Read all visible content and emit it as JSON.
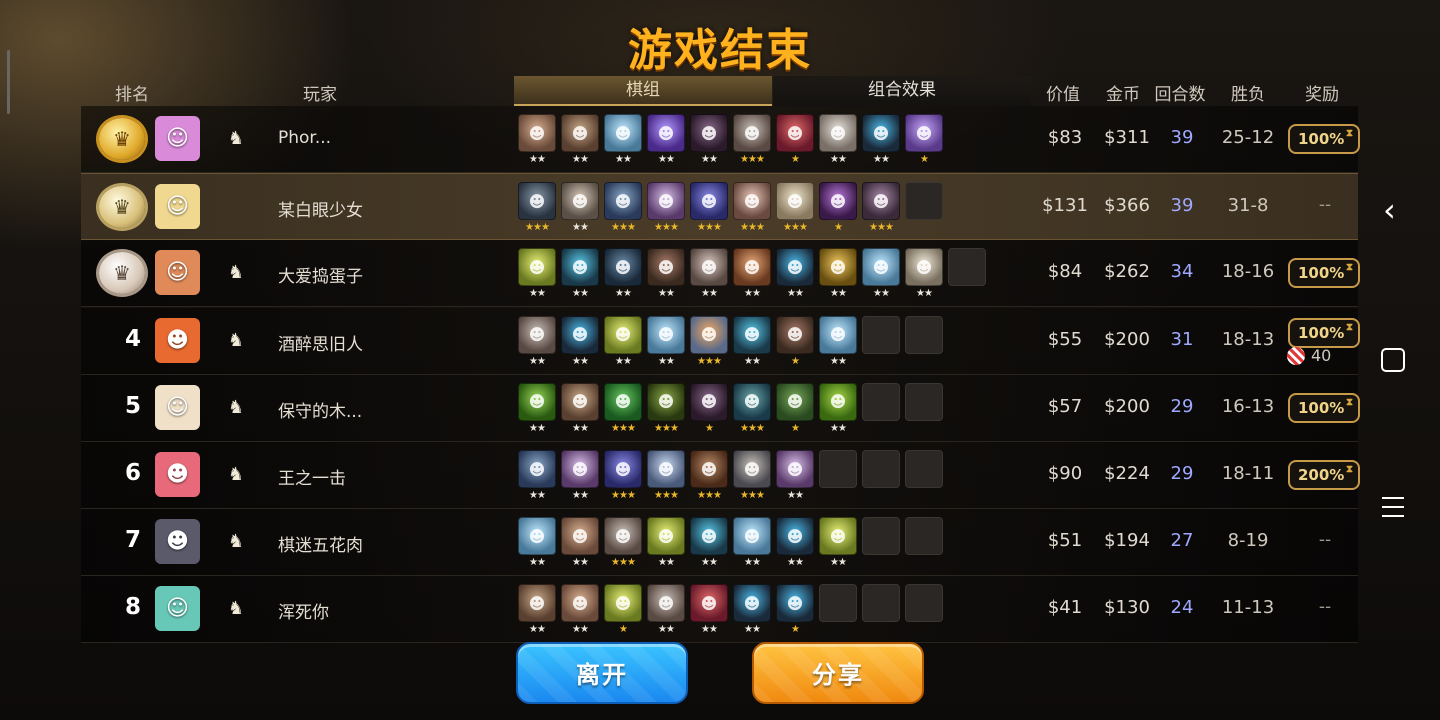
{
  "title": "游戏结束",
  "headers": {
    "rank": "排名",
    "player": "玩家",
    "deck_tab": "棋组",
    "synergy_tab": "组合效果",
    "value": "价值",
    "gold": "金币",
    "rounds": "回合数",
    "win_loss": "胜负",
    "reward": "奖励"
  },
  "rows": [
    {
      "rank": "",
      "medal": "gold",
      "medal_glyph": "♛",
      "avatar_color": "#d98ad8",
      "avatar_glyph": "☺",
      "name": "Phor...",
      "value": "$83",
      "gold": "$311",
      "rounds": "39",
      "win_loss": "25-12",
      "reward": "100%",
      "bonus": "",
      "units": [
        {
          "c1": "#d8b090",
          "c2": "#6a4a3a",
          "stars": "★★",
          "s": 2
        },
        {
          "c1": "#c8a888",
          "c2": "#5a4030",
          "stars": "★★",
          "s": 2
        },
        {
          "c1": "#bfe8ff",
          "c2": "#4a7a9a",
          "stars": "★★",
          "s": 2
        },
        {
          "c1": "#b49aff",
          "c2": "#4a2a8a",
          "stars": "★★",
          "s": 2
        },
        {
          "c1": "#8a6a8a",
          "c2": "#2a1a2a",
          "stars": "★★",
          "s": 2
        },
        {
          "c1": "#c8c0b8",
          "c2": "#5a4a44",
          "stars": "★★★",
          "s": 3
        },
        {
          "c1": "#e06a6a",
          "c2": "#6a1a2a",
          "stars": "★",
          "s": 1
        },
        {
          "c1": "#e8e4dc",
          "c2": "#7a7068",
          "stars": "★★",
          "s": 2
        },
        {
          "c1": "#4ab8e8",
          "c2": "#1a2a3a",
          "stars": "★★",
          "s": 2
        },
        {
          "c1": "#c8a8f8",
          "c2": "#5a3a8a",
          "stars": "★",
          "s": 1
        }
      ]
    },
    {
      "rank": "",
      "medal": "silver",
      "medal_glyph": "♛",
      "avatar_color": "#f0d890",
      "avatar_glyph": "☺",
      "name": "某白眼少女",
      "value": "$131",
      "gold": "$366",
      "rounds": "39",
      "win_loss": "31-8",
      "reward": "",
      "bonus": "",
      "me": true,
      "units": [
        {
          "c1": "#8898a8",
          "c2": "#2a3440",
          "stars": "★★★",
          "s": 3
        },
        {
          "c1": "#d8c8b8",
          "c2": "#5a5048",
          "stars": "★★",
          "s": 2
        },
        {
          "c1": "#8aa8c8",
          "c2": "#2a3a5a",
          "stars": "★★★",
          "s": 3
        },
        {
          "c1": "#d8c0e8",
          "c2": "#5a3a6a",
          "stars": "★★★",
          "s": 3
        },
        {
          "c1": "#8a8ae8",
          "c2": "#2a2a6a",
          "stars": "★★★",
          "s": 3
        },
        {
          "c1": "#e8c8b8",
          "c2": "#6a4a40",
          "stars": "★★★",
          "s": 3
        },
        {
          "c1": "#f0e8d0",
          "c2": "#8a7a60",
          "stars": "★★★",
          "s": 3
        },
        {
          "c1": "#b878d8",
          "c2": "#3a1a4a",
          "stars": "★",
          "s": 1
        },
        {
          "c1": "#a88aa8",
          "c2": "#3a2a3a",
          "stars": "★★★",
          "s": 3
        },
        {
          "empty": true
        }
      ]
    },
    {
      "rank": "",
      "medal": "bronze",
      "medal_glyph": "♛",
      "avatar_color": "#e08a5a",
      "avatar_glyph": "☺",
      "name": "大爱捣蛋子",
      "value": "$84",
      "gold": "$262",
      "rounds": "34",
      "win_loss": "18-16",
      "reward": "100%",
      "bonus": "",
      "units": [
        {
          "c1": "#e8f078",
          "c2": "#6a7a20",
          "stars": "★★",
          "s": 2
        },
        {
          "c1": "#58c8e8",
          "c2": "#1a3a4a",
          "stars": "★★",
          "s": 2
        },
        {
          "c1": "#6a8aa8",
          "c2": "#1a2a3a",
          "stars": "★★",
          "s": 2
        },
        {
          "c1": "#a87a68",
          "c2": "#3a2a20",
          "stars": "★★",
          "s": 2
        },
        {
          "c1": "#d8c8c0",
          "c2": "#5a4a44",
          "stars": "★★",
          "s": 2
        },
        {
          "c1": "#e8a878",
          "c2": "#6a3a20",
          "stars": "★★",
          "s": 2
        },
        {
          "c1": "#4ab8e8",
          "c2": "#1a2a3a",
          "stars": "★★",
          "s": 2
        },
        {
          "c1": "#f0c860",
          "c2": "#6a5010",
          "stars": "★★",
          "s": 2
        },
        {
          "c1": "#bfe8ff",
          "c2": "#4a7a9a",
          "stars": "★★",
          "s": 2
        },
        {
          "c1": "#f0e8d8",
          "c2": "#7a7060",
          "stars": "★★",
          "s": 2
        },
        {
          "empty": true
        }
      ]
    },
    {
      "rank": "4",
      "medal": "",
      "medal_glyph": "",
      "avatar_color": "#e86a30",
      "avatar_glyph": "☻",
      "name": "酒醉思旧人",
      "value": "$55",
      "gold": "$200",
      "rounds": "31",
      "win_loss": "18-13",
      "reward": "100%",
      "bonus": "40",
      "units": [
        {
          "c1": "#c8c0b8",
          "c2": "#5a4a44",
          "stars": "★★",
          "s": 2
        },
        {
          "c1": "#4ab8e8",
          "c2": "#1a2a3a",
          "stars": "★★",
          "s": 2
        },
        {
          "c1": "#e8f078",
          "c2": "#6a7a20",
          "stars": "★★",
          "s": 2
        },
        {
          "c1": "#bfe8ff",
          "c2": "#4a7a9a",
          "stars": "★★",
          "s": 2
        },
        {
          "c1": "#f0a860",
          "c2": "#5a6a8a",
          "stars": "★★★",
          "s": 3
        },
        {
          "c1": "#58c8e8",
          "c2": "#1a3a4a",
          "stars": "★★",
          "s": 2
        },
        {
          "c1": "#a87a68",
          "c2": "#3a2a20",
          "stars": "★",
          "s": 1
        },
        {
          "c1": "#bfe8ff",
          "c2": "#4a7a9a",
          "stars": "★★",
          "s": 2
        },
        {
          "empty": true
        },
        {
          "empty": true
        }
      ]
    },
    {
      "rank": "5",
      "medal": "",
      "medal_glyph": "",
      "avatar_color": "#f0e0c8",
      "avatar_glyph": "☺",
      "name": "保守的木...",
      "value": "$57",
      "gold": "$200",
      "rounds": "29",
      "win_loss": "16-13",
      "reward": "100%",
      "bonus": "",
      "units": [
        {
          "c1": "#98d858",
          "c2": "#2a5a10",
          "stars": "★★",
          "s": 2
        },
        {
          "c1": "#c8a888",
          "c2": "#5a4030",
          "stars": "★★",
          "s": 2
        },
        {
          "c1": "#68c860",
          "c2": "#1a5a20",
          "stars": "★★★",
          "s": 3
        },
        {
          "c1": "#8aa848",
          "c2": "#2a3a10",
          "stars": "★★★",
          "s": 3
        },
        {
          "c1": "#8a6a8a",
          "c2": "#2a1a2a",
          "stars": "★",
          "s": 1
        },
        {
          "c1": "#6aa8a8",
          "c2": "#1a3a4a",
          "stars": "★★★",
          "s": 3
        },
        {
          "c1": "#78a858",
          "c2": "#2a4a20",
          "stars": "★",
          "s": 1
        },
        {
          "c1": "#a8d848",
          "c2": "#3a6a10",
          "stars": "★★",
          "s": 2
        },
        {
          "empty": true
        },
        {
          "empty": true
        }
      ]
    },
    {
      "rank": "6",
      "medal": "",
      "medal_glyph": "",
      "avatar_color": "#e86a7a",
      "avatar_glyph": "☻",
      "name": "王之一击",
      "value": "$90",
      "gold": "$224",
      "rounds": "29",
      "win_loss": "18-11",
      "reward": "200%",
      "bonus": "",
      "units": [
        {
          "c1": "#8aa8c8",
          "c2": "#2a3a5a",
          "stars": "★★",
          "s": 2
        },
        {
          "c1": "#d8c0e8",
          "c2": "#5a3a6a",
          "stars": "★★",
          "s": 2
        },
        {
          "c1": "#8a8ae8",
          "c2": "#2a2a6a",
          "stars": "★★★",
          "s": 3
        },
        {
          "c1": "#c8d8f0",
          "c2": "#4a5a7a",
          "stars": "★★★",
          "s": 3
        },
        {
          "c1": "#b88a68",
          "c2": "#4a2a18",
          "stars": "★★★",
          "s": 3
        },
        {
          "c1": "#c8c0b8",
          "c2": "#4a4a50",
          "stars": "★★★",
          "s": 3
        },
        {
          "c1": "#d8c0e8",
          "c2": "#5a3a6a",
          "stars": "★★",
          "s": 2
        },
        {
          "empty": true
        },
        {
          "empty": true
        },
        {
          "empty": true
        }
      ]
    },
    {
      "rank": "7",
      "medal": "",
      "medal_glyph": "",
      "avatar_color": "#5a5a6a",
      "avatar_glyph": "☻",
      "name": "棋迷五花肉",
      "value": "$51",
      "gold": "$194",
      "rounds": "27",
      "win_loss": "8-19",
      "reward": "",
      "bonus": "",
      "units": [
        {
          "c1": "#bfe8ff",
          "c2": "#4a7a9a",
          "stars": "★★",
          "s": 2
        },
        {
          "c1": "#d8b090",
          "c2": "#6a4a3a",
          "stars": "★★",
          "s": 2
        },
        {
          "c1": "#c8c0b8",
          "c2": "#5a4a44",
          "stars": "★★★",
          "s": 3
        },
        {
          "c1": "#e8f078",
          "c2": "#6a7a20",
          "stars": "★★",
          "s": 2
        },
        {
          "c1": "#58c8e8",
          "c2": "#1a3a4a",
          "stars": "★★",
          "s": 2
        },
        {
          "c1": "#bfe8ff",
          "c2": "#4a7a9a",
          "stars": "★★",
          "s": 2
        },
        {
          "c1": "#4ab8e8",
          "c2": "#1a2a3a",
          "stars": "★★",
          "s": 2
        },
        {
          "c1": "#e8f078",
          "c2": "#6a7a20",
          "stars": "★★",
          "s": 2
        },
        {
          "empty": true
        },
        {
          "empty": true
        }
      ]
    },
    {
      "rank": "8",
      "medal": "",
      "medal_glyph": "",
      "avatar_color": "#68c8b8",
      "avatar_glyph": "☺",
      "name": "浑死你",
      "value": "$41",
      "gold": "$130",
      "rounds": "24",
      "win_loss": "11-13",
      "reward": "",
      "bonus": "",
      "units": [
        {
          "c1": "#c8a888",
          "c2": "#5a4030",
          "stars": "★★",
          "s": 2
        },
        {
          "c1": "#d8b090",
          "c2": "#6a4a3a",
          "stars": "★★",
          "s": 2
        },
        {
          "c1": "#e8f078",
          "c2": "#6a7a20",
          "stars": "★",
          "s": 1
        },
        {
          "c1": "#c8c0b8",
          "c2": "#5a4a44",
          "stars": "★★",
          "s": 2
        },
        {
          "c1": "#e06a6a",
          "c2": "#6a1a2a",
          "stars": "★★",
          "s": 2
        },
        {
          "c1": "#4ab8e8",
          "c2": "#1a2a3a",
          "stars": "★★",
          "s": 2
        },
        {
          "c1": "#4ab8e8",
          "c2": "#1a2a3a",
          "stars": "★",
          "s": 1
        },
        {
          "empty": true
        },
        {
          "empty": true
        },
        {
          "empty": true
        }
      ]
    }
  ],
  "empty_reward": "--",
  "buttons": {
    "leave": "离开",
    "share": "分享"
  },
  "nav": {
    "back_icon": "‹"
  },
  "icons": {
    "add_friend": "add-friend-icon",
    "candy": "candy-icon"
  }
}
